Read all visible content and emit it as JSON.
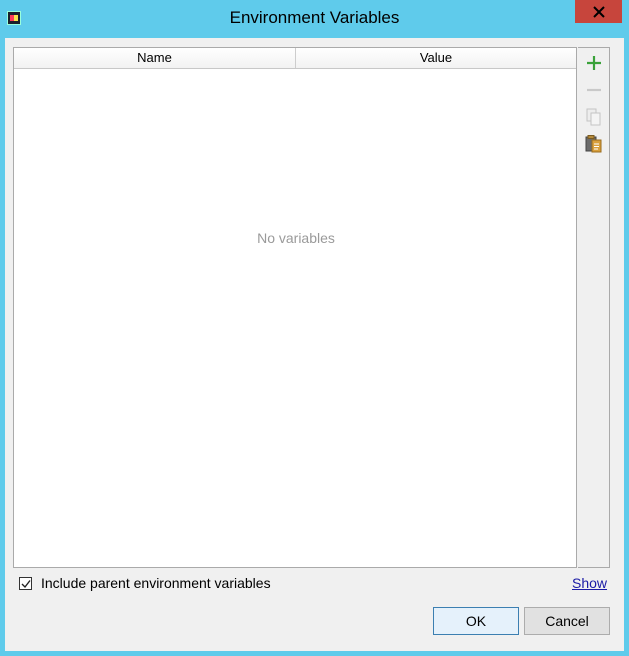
{
  "window": {
    "title": "Environment Variables",
    "close_icon": "close-icon"
  },
  "table": {
    "columns": [
      "Name",
      "Value"
    ],
    "empty_text": "No variables"
  },
  "toolbar": {
    "add_icon": "plus-icon",
    "remove_icon": "minus-icon",
    "copy_icon": "copy-icon",
    "paste_icon": "paste-icon"
  },
  "options": {
    "include_parent_label": "Include parent environment variables",
    "include_parent_checked": true,
    "show_link": "Show"
  },
  "buttons": {
    "ok": "OK",
    "cancel": "Cancel"
  },
  "colors": {
    "titlebar": "#5fcbeb",
    "close": "#c7453c",
    "add": "#3aa23a"
  }
}
